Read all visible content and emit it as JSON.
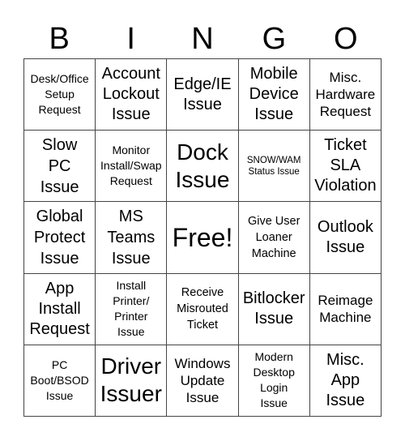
{
  "header": {
    "letters": [
      "B",
      "I",
      "N",
      "G",
      "O"
    ]
  },
  "cells": [
    {
      "text": "Desk/Office\nSetup\nRequest",
      "size": "s-sm"
    },
    {
      "text": "Account\nLockout\nIssue",
      "size": "s-lg"
    },
    {
      "text": "Edge/IE\nIssue",
      "size": "s-lg"
    },
    {
      "text": "Mobile\nDevice\nIssue",
      "size": "s-lg"
    },
    {
      "text": "Misc.\nHardware\nRequest",
      "size": "s-md"
    },
    {
      "text": "Slow\nPC\nIssue",
      "size": "s-lg2"
    },
    {
      "text": "Monitor\nInstall/Swap\nRequest",
      "size": "s-sm"
    },
    {
      "text": "Dock\nIssue",
      "size": "s-xl"
    },
    {
      "text": "SNOW/WAM\nStatus Issue",
      "size": "s-xs"
    },
    {
      "text": "Ticket\nSLA\nViolation",
      "size": "s-lg"
    },
    {
      "text": "Global\nProtect\nIssue",
      "size": "s-lg2"
    },
    {
      "text": "MS\nTeams\nIssue",
      "size": "s-lg2"
    },
    {
      "text": "Free!",
      "size": "s-xxl"
    },
    {
      "text": "Give User\nLoaner\nMachine",
      "size": "s-sm2"
    },
    {
      "text": "Outlook\nIssue",
      "size": "s-lg"
    },
    {
      "text": "App\nInstall\nRequest",
      "size": "s-lg"
    },
    {
      "text": "Install\nPrinter/\nPrinter\nIssue",
      "size": "s-sm"
    },
    {
      "text": "Receive\nMisrouted\nTicket",
      "size": "s-sm2"
    },
    {
      "text": "Bitlocker\nIssue",
      "size": "s-lg"
    },
    {
      "text": "Reimage\nMachine",
      "size": "s-md"
    },
    {
      "text": "PC\nBoot/BSOD\nIssue",
      "size": "s-sm"
    },
    {
      "text": "Driver\nIssuer",
      "size": "s-xl"
    },
    {
      "text": "Windows\nUpdate\nIssue",
      "size": "s-md"
    },
    {
      "text": "Modern\nDesktop\nLogin\nIssue",
      "size": "s-sm"
    },
    {
      "text": "Misc.\nApp\nIssue",
      "size": "s-lg"
    }
  ]
}
